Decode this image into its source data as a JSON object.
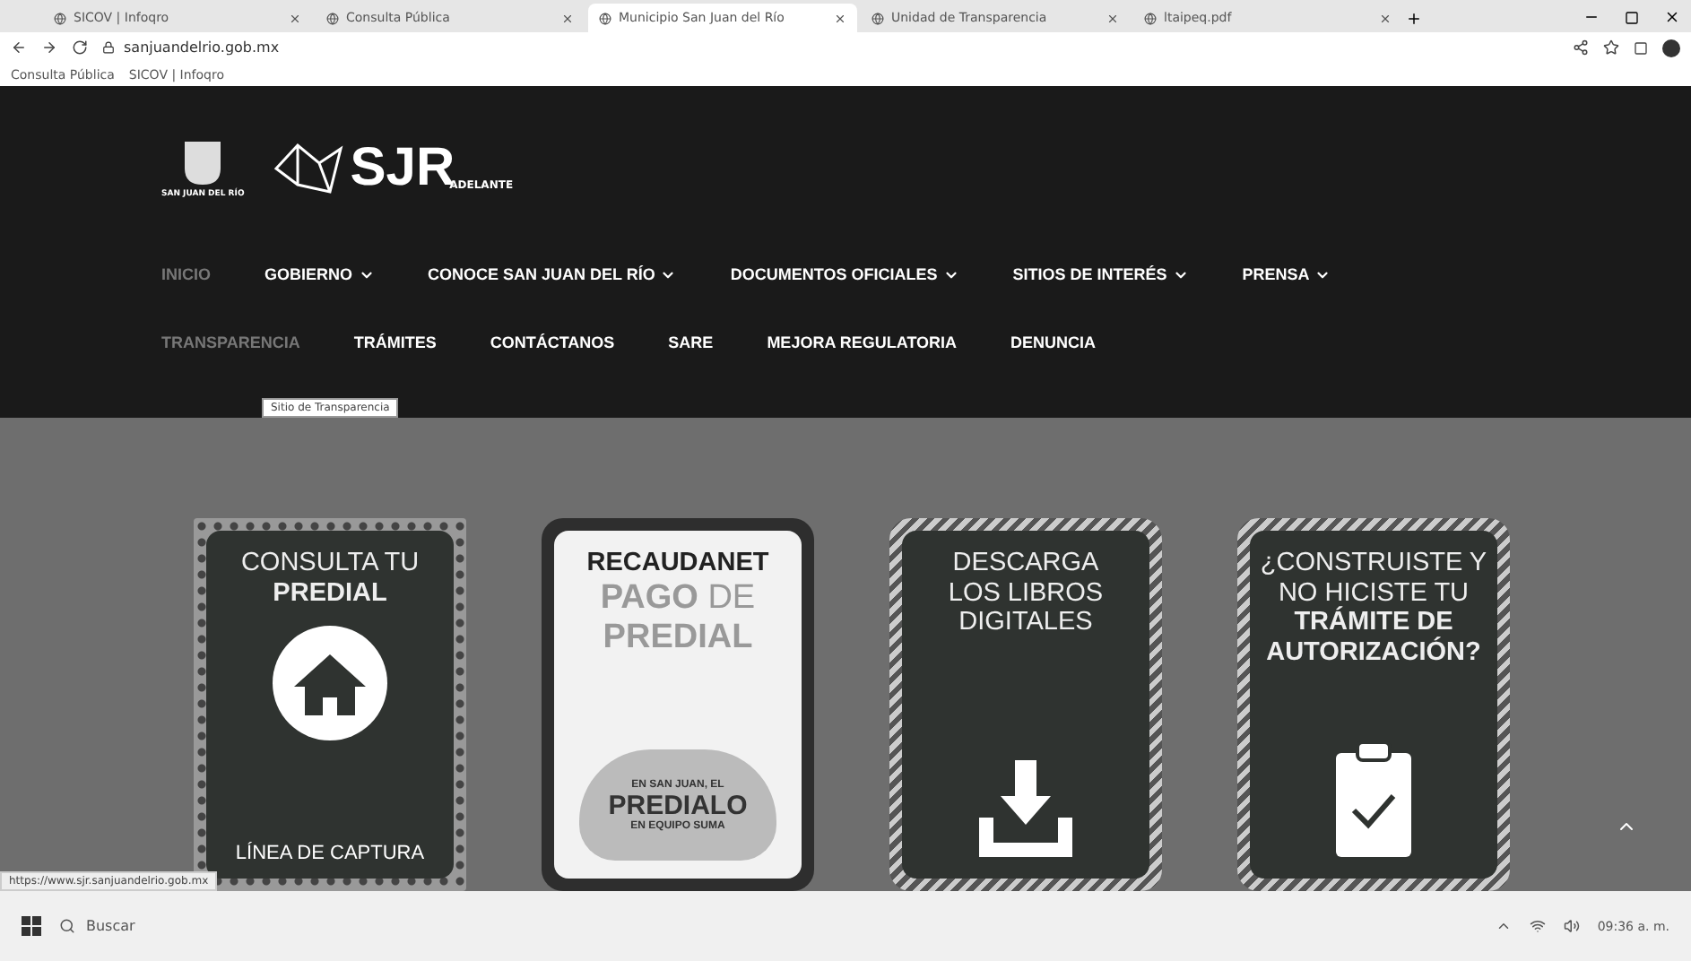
{
  "browser": {
    "tabs": [
      {
        "label": "SICOV | Infoqro",
        "selected": false
      },
      {
        "label": "Consulta Pública",
        "selected": false
      },
      {
        "label": "Municipio San Juan del Río",
        "selected": true
      },
      {
        "label": "Unidad de Transparencia",
        "selected": false
      },
      {
        "label": "ltaipeq.pdf",
        "selected": false
      }
    ],
    "address": "sanjuandelrio.gob.mx",
    "bookmarks": [
      "Consulta Pública",
      "SICOV | Infoqro"
    ]
  },
  "header": {
    "crest_text": "SAN JUAN DEL RÍO",
    "logo_text": "SJR",
    "logo_tagline": "ADELANTE",
    "nav_rows": [
      [
        {
          "label": "INICIO",
          "dimmed": true,
          "has_menu": false
        },
        {
          "label": "GOBIERNO",
          "dimmed": false,
          "has_menu": true
        },
        {
          "label": "CONOCE SAN JUAN DEL RÍO",
          "dimmed": false,
          "has_menu": true
        },
        {
          "label": "DOCUMENTOS OFICIALES",
          "dimmed": false,
          "has_menu": true
        },
        {
          "label": "SITIOS DE INTERÉS",
          "dimmed": false,
          "has_menu": true
        },
        {
          "label": "PRENSA",
          "dimmed": false,
          "has_menu": true
        }
      ],
      [
        {
          "label": "TRANSPARENCIA",
          "dimmed": true,
          "has_menu": false
        },
        {
          "label": "TRÁMITES",
          "dimmed": false,
          "has_menu": false
        },
        {
          "label": "CONTÁCTANOS",
          "dimmed": false,
          "has_menu": false
        },
        {
          "label": "SARE",
          "dimmed": false,
          "has_menu": false
        },
        {
          "label": "MEJORA REGULATORIA",
          "dimmed": false,
          "has_menu": false
        },
        {
          "label": "DENUNCIA",
          "dimmed": false,
          "has_menu": false
        }
      ]
    ],
    "tooltip": "Sitio de Transparencia"
  },
  "cards": [
    {
      "kind": "predial",
      "lines": [
        "CONSULTA TU",
        "**PREDIAL**"
      ],
      "footer": "LÍNEA DE CAPTURA"
    },
    {
      "kind": "recaudanet",
      "lines": [
        "RECAUDANET",
        "**PAGO** DE",
        "**PREDIAL**"
      ],
      "badge": [
        "EN SAN JUAN, EL",
        "PREDIALO",
        "EN EQUIPO SUMA"
      ]
    },
    {
      "kind": "libros",
      "lines": [
        "DESCARGA",
        "LOS LIBROS",
        "DIGITALES"
      ]
    },
    {
      "kind": "tramite",
      "lines": [
        "¿CONSTRUISTE Y",
        "NO HICISTE TU",
        "**TRÁMITE DE**",
        "**AUTORIZACIÓN?**"
      ]
    }
  ],
  "status_url": "https://www.sjr.sanjuandelrio.gob.mx",
  "taskbar": {
    "search_placeholder": "Buscar",
    "time": "09:36 a. m."
  }
}
